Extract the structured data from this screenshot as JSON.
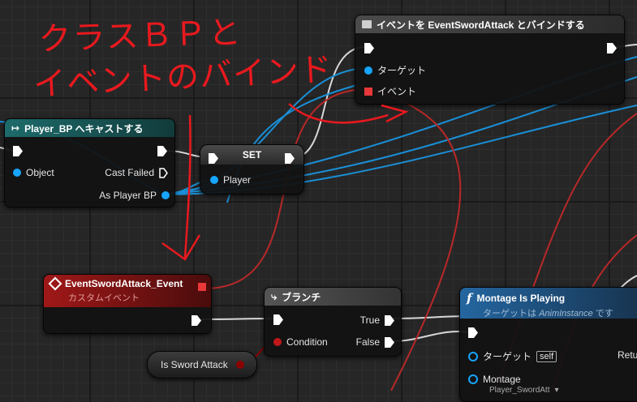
{
  "annotation_text": [
    "クラスＢＰと",
    "イベントのバインド"
  ],
  "nodes": {
    "cast": {
      "title": "Player_BP へキャストする",
      "object_label": "Object",
      "cast_failed_label": "Cast Failed",
      "as_player_label": "As Player BP"
    },
    "set": {
      "title": "SET",
      "player_label": "Player"
    },
    "bind": {
      "title": "イベントを EventSwordAttack とバインドする",
      "target_label": "ターゲット",
      "event_label": "イベント"
    },
    "custom_event": {
      "title": "EventSwordAttack_Event",
      "subtitle": "カスタムイベント"
    },
    "branch": {
      "title": "ブランチ",
      "condition_label": "Condition",
      "true_label": "True",
      "false_label": "False"
    },
    "is_sword_attack": {
      "label": "Is Sword Attack"
    },
    "montage": {
      "title": "Montage Is Playing",
      "subtitle_prefix": "ターゲットは ",
      "subtitle_class": "AnimInstance",
      "subtitle_suffix": " です",
      "target_label": "ターゲット",
      "self_label": "self",
      "return_label": "Retu",
      "montage_label": "Montage",
      "montage_value": "Player_SwordAtt"
    }
  },
  "colors": {
    "cast_header": "#1e6b6b",
    "bind_header": "#3b3b3b",
    "event_header": "#8c1414",
    "function_header": "#1b4d7a",
    "object_wire": "#1a8fd6",
    "delegate_wire": "#b82828",
    "exec_wire": "#d8d8d8",
    "annotation": "#e8191e"
  }
}
